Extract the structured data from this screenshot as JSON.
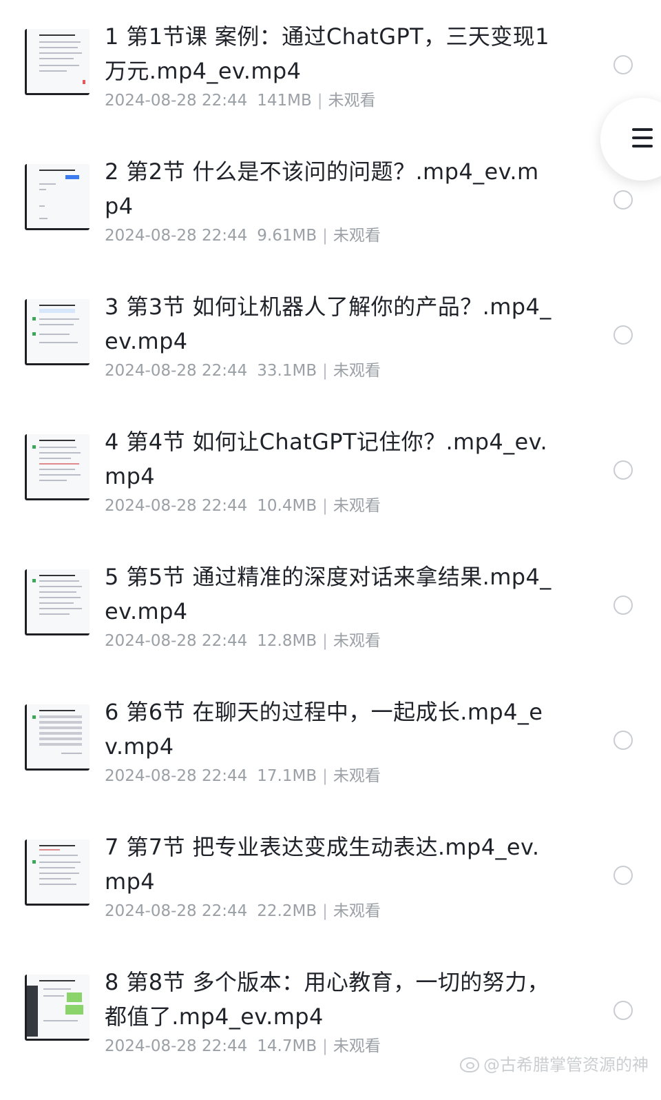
{
  "files": [
    {
      "title": "1 第1节课  案例：通过ChatGPT，三天变现1万元.mp4_ev.mp4",
      "date": "2024-08-28 22:44",
      "size": "141MB",
      "status": "未观看"
    },
    {
      "title": "2 第2节  什么是不该问的问题？.mp4_ev.mp4",
      "date": "2024-08-28 22:44",
      "size": "9.61MB",
      "status": "未观看"
    },
    {
      "title": "3 第3节  如何让机器人了解你的产品？.mp4_ev.mp4",
      "date": "2024-08-28 22:44",
      "size": "33.1MB",
      "status": "未观看"
    },
    {
      "title": "4 第4节  如何让ChatGPT记住你？.mp4_ev.mp4",
      "date": "2024-08-28 22:44",
      "size": "10.4MB",
      "status": "未观看"
    },
    {
      "title": "5 第5节  通过精准的深度对话来拿结果.mp4_ev.mp4",
      "date": "2024-08-28 22:44",
      "size": "12.8MB",
      "status": "未观看"
    },
    {
      "title": "6 第6节  在聊天的过程中，一起成长.mp4_ev.mp4",
      "date": "2024-08-28 22:44",
      "size": "17.1MB",
      "status": "未观看"
    },
    {
      "title": "7 第7节 把专业表达变成生动表达.mp4_ev.mp4",
      "date": "2024-08-28 22:44",
      "size": "22.2MB",
      "status": "未观看"
    },
    {
      "title": "8 第8节 多个版本：用心教育，一切的努力，都值了.mp4_ev.mp4",
      "date": "2024-08-28 22:44",
      "size": "14.7MB",
      "status": "未观看"
    }
  ],
  "meta_separator": "|",
  "floating_menu": {
    "icon": "menu-icon"
  },
  "watermark": {
    "text": "@古希腊掌管资源的神"
  }
}
